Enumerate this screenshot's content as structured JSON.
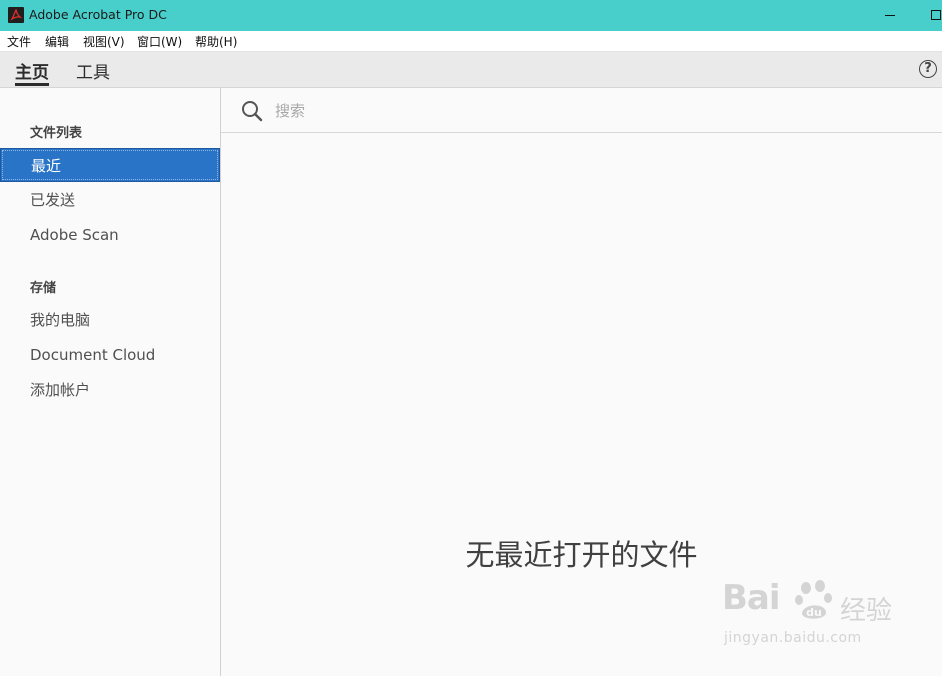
{
  "window": {
    "title": "Adobe Acrobat Pro DC"
  },
  "menubar": {
    "items": [
      {
        "label": "文件"
      },
      {
        "label": "编辑"
      },
      {
        "label": "视图(V)"
      },
      {
        "label": "窗口(W)"
      },
      {
        "label": "帮助(H)"
      }
    ]
  },
  "tabs": [
    {
      "label": "主页",
      "active": true
    },
    {
      "label": "工具",
      "active": false
    }
  ],
  "sidebar": {
    "file_list_title": "文件列表",
    "file_items": [
      {
        "label": "最近",
        "selected": true
      },
      {
        "label": "已发送",
        "selected": false
      },
      {
        "label": "Adobe Scan",
        "selected": false
      }
    ],
    "storage_title": "存储",
    "storage_items": [
      {
        "label": "我的电脑"
      },
      {
        "label": "Document Cloud"
      },
      {
        "label": "添加帐户"
      }
    ]
  },
  "search": {
    "placeholder": "搜索",
    "value": ""
  },
  "main": {
    "empty_message": "无最近打开的文件"
  },
  "watermark": {
    "brand": "Bai",
    "suffix": "经验",
    "url": "jingyan.baidu.com"
  },
  "colors": {
    "titlebar": "#48cfcb",
    "selection": "#2a74c7"
  }
}
